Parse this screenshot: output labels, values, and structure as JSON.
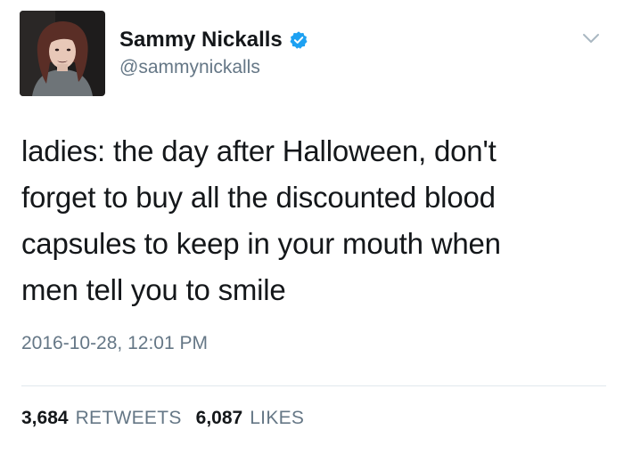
{
  "author": {
    "display_name": "Sammy Nickalls",
    "handle": "@sammynickalls",
    "verified": true
  },
  "tweet": {
    "text_lines": [
      "ladies: the day after Halloween, don't",
      "forget to buy all the discounted blood",
      "capsules to keep in your mouth when",
      "men tell you to smile"
    ],
    "timestamp": "2016-10-28, 12:01 PM"
  },
  "stats": {
    "retweets_count": "3,684",
    "retweets_label": "RETWEETS",
    "likes_count": "6,087",
    "likes_label": "LIKES"
  },
  "icons": {
    "verified": "verified-badge-icon",
    "menu": "chevron-down-icon"
  },
  "colors": {
    "text": "#14171a",
    "secondary": "#657786",
    "verified_blue": "#1da1f2",
    "divider": "#e1e8ed"
  }
}
